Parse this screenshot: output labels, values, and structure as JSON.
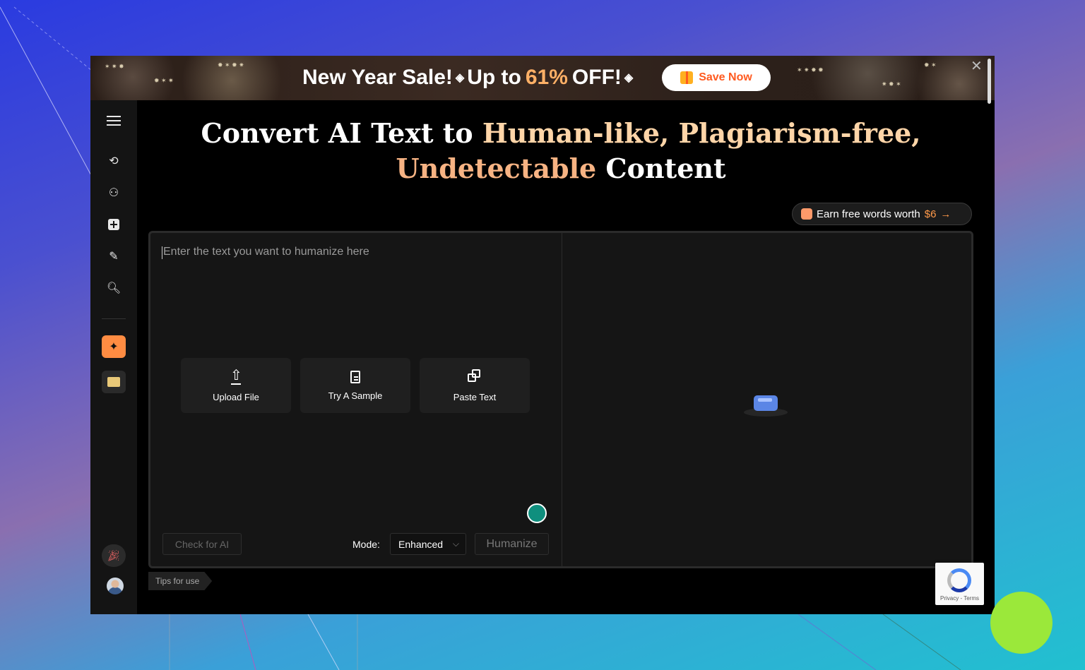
{
  "banner": {
    "title": "New Year Sale!",
    "offer_prefix": "Up to",
    "offer_percent": "61%",
    "offer_suffix": "OFF!",
    "cta_label": "Save Now",
    "close_icon": "close-icon"
  },
  "sidebar": {
    "items": [
      {
        "icon": "menu-icon"
      },
      {
        "icon": "refresh-ai-icon"
      },
      {
        "icon": "humanize-icon"
      },
      {
        "icon": "add-icon"
      },
      {
        "icon": "paraphrase-icon"
      },
      {
        "icon": "detector-icon"
      },
      {
        "icon": "sparkle-icon"
      },
      {
        "icon": "notes-icon"
      },
      {
        "icon": "party-icon"
      },
      {
        "icon": "avatar"
      }
    ]
  },
  "headline": {
    "part1": "Convert AI Text to ",
    "highlight1": "Human-like, Plagiarism-free,",
    "highlight2": "Undetectable",
    "part2": " Content"
  },
  "earn": {
    "label": "Earn free words worth",
    "amount": "$6",
    "arrow": "→"
  },
  "editor": {
    "placeholder": "Enter the text you want to humanize here",
    "actions": [
      {
        "label": "Upload File",
        "icon": "upload-icon"
      },
      {
        "label": "Try A Sample",
        "icon": "document-icon"
      },
      {
        "label": "Paste Text",
        "icon": "copy-icon"
      }
    ],
    "check_label": "Check for AI",
    "mode_label": "Mode:",
    "mode_value": "Enhanced",
    "humanize_label": "Humanize"
  },
  "tips_label": "Tips for use",
  "recaptcha": {
    "label": "Privacy - Terms"
  },
  "colors": {
    "accent": "#ff8c42",
    "highlight": "#ffd5a8",
    "cta": "#ff5a1f"
  }
}
